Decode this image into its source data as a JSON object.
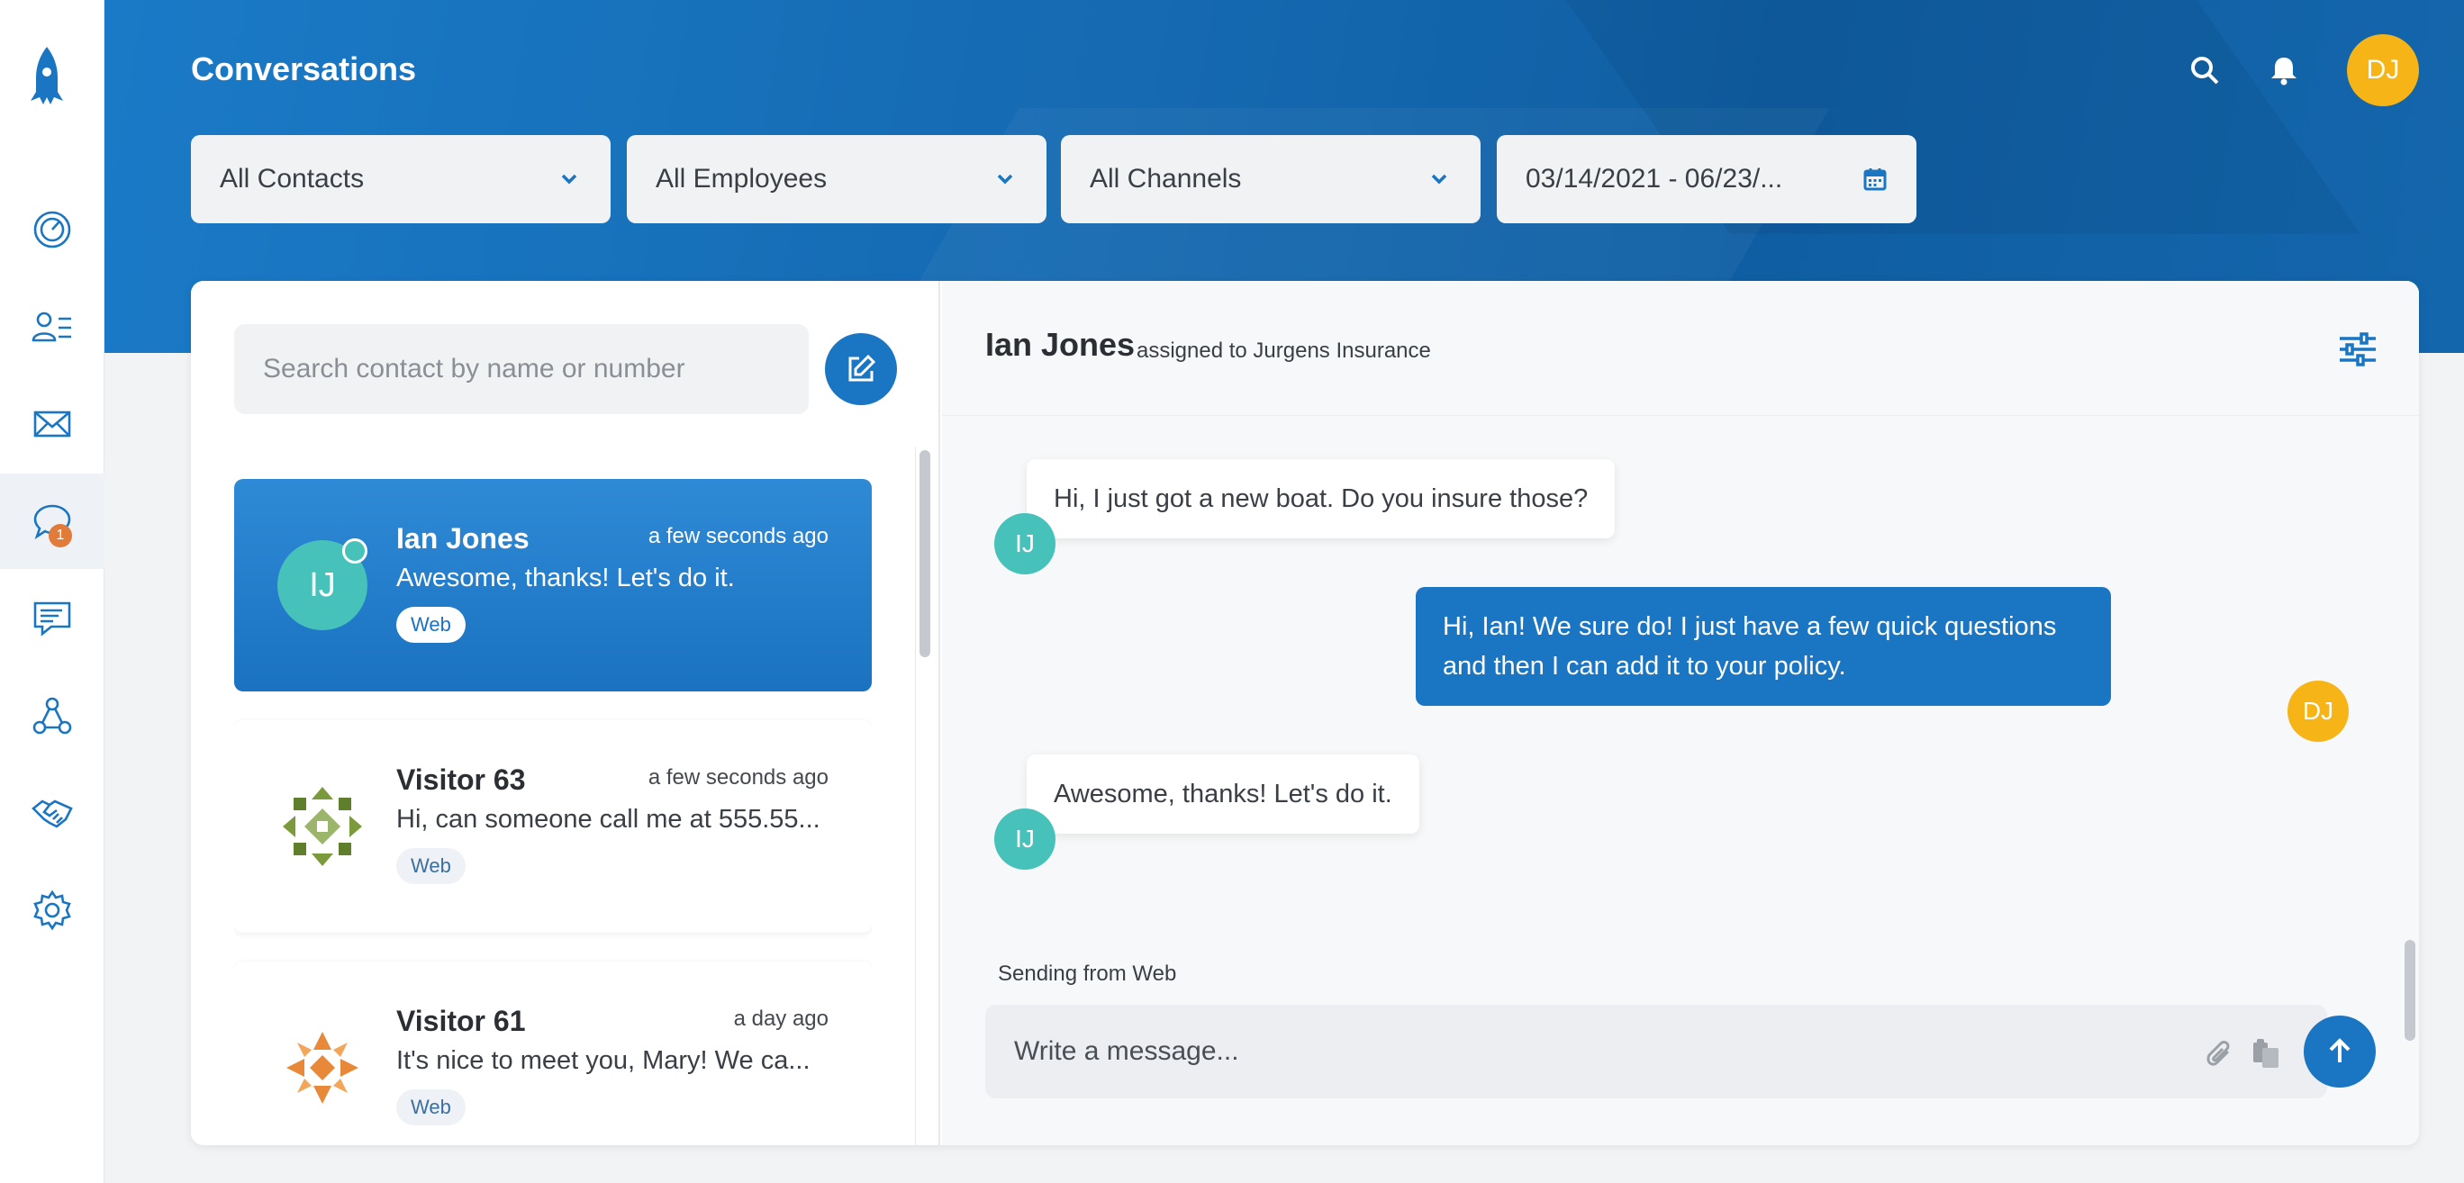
{
  "app": {
    "title": "Conversations",
    "user_initials": "DJ"
  },
  "colors": {
    "brand": "#1a75c2",
    "accent_yellow": "#f6b417",
    "teal": "#46c2bb",
    "badge": "#e07b39"
  },
  "sidebar": {
    "items": [
      {
        "icon": "dashboard-gauge-icon"
      },
      {
        "icon": "contacts-list-icon"
      },
      {
        "icon": "mail-icon"
      },
      {
        "icon": "chat-bubble-icon",
        "badge": "1",
        "active": true
      },
      {
        "icon": "forms-survey-icon"
      },
      {
        "icon": "workflow-nodes-icon"
      },
      {
        "icon": "handshake-icon"
      },
      {
        "icon": "settings-gear-icon"
      }
    ]
  },
  "filters": {
    "contacts": "All Contacts",
    "employees": "All Employees",
    "channels": "All Channels",
    "date_range": "03/14/2021 - 06/23/..."
  },
  "search": {
    "placeholder": "Search contact by name or number"
  },
  "conversations": [
    {
      "initials": "IJ",
      "name": "Ian Jones",
      "time": "a few seconds ago",
      "message": "Awesome, thanks! Let's do it.",
      "channel": "Web",
      "active": true
    },
    {
      "initials": "",
      "name": "Visitor 63",
      "time": "a few seconds ago",
      "message": "Hi, can someone call me at 555.55...",
      "channel": "Web",
      "active": false
    },
    {
      "initials": "",
      "name": "Visitor 61",
      "time": "a day ago",
      "message": "It's nice to meet you, Mary! We ca...",
      "channel": "Web",
      "active": false
    }
  ],
  "chat": {
    "contact_name": "Ian Jones",
    "assigned_text": "assigned to Jurgens Insurance",
    "messages": [
      {
        "from": "contact",
        "initials": "IJ",
        "text": "Hi, I just got a new boat. Do you insure those?"
      },
      {
        "from": "agent",
        "initials": "DJ",
        "text": "Hi, Ian! We sure do! I just have a few quick questions and then I can add it to your policy."
      },
      {
        "from": "contact",
        "initials": "IJ",
        "text": "Awesome, thanks! Let's do it."
      }
    ],
    "sending_from": "Sending from Web",
    "composer_placeholder": "Write a message..."
  }
}
